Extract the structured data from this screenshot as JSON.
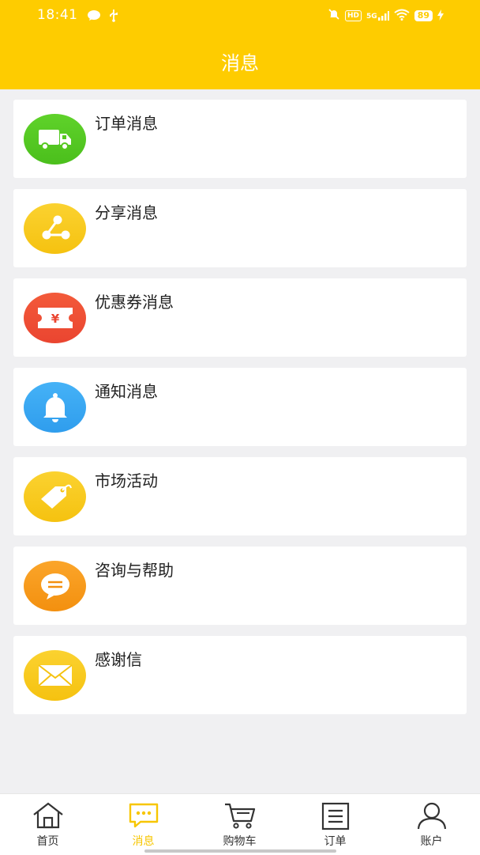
{
  "status_bar": {
    "time": "18:41",
    "hd": "HD",
    "signal": "5G",
    "battery": "89"
  },
  "header": {
    "title": "消息"
  },
  "items": [
    {
      "label": "订单消息",
      "icon": "truck-icon",
      "color": "#55c81e"
    },
    {
      "label": "分享消息",
      "icon": "share-icon",
      "color": "#f8c81a"
    },
    {
      "label": "优惠券消息",
      "icon": "coupon-icon",
      "color": "#f0503a",
      "glyph": "¥"
    },
    {
      "label": "通知消息",
      "icon": "bell-icon",
      "color": "#3aa6f2"
    },
    {
      "label": "市场活动",
      "icon": "tag-icon",
      "color": "#f8c81a"
    },
    {
      "label": "咨询与帮助",
      "icon": "chat-bubble-icon",
      "color": "#f89a1a"
    },
    {
      "label": "感谢信",
      "icon": "envelope-icon",
      "color": "#f8c81a"
    }
  ],
  "tabbar": {
    "active_color": "#f7c600",
    "tabs": [
      {
        "label": "首页",
        "icon": "home-icon"
      },
      {
        "label": "消息",
        "icon": "message-icon",
        "active": true
      },
      {
        "label": "购物车",
        "icon": "cart-icon"
      },
      {
        "label": "订单",
        "icon": "order-list-icon"
      },
      {
        "label": "账户",
        "icon": "user-icon"
      }
    ]
  }
}
